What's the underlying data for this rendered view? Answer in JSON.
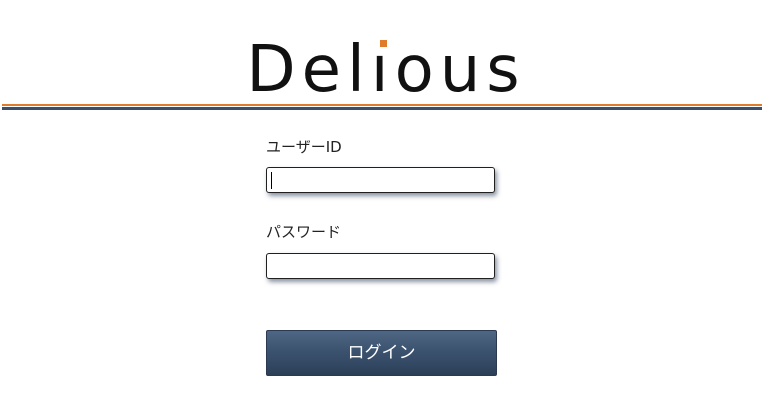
{
  "brand": {
    "logo_prefix": "Del",
    "logo_i": "ı",
    "logo_suffix": "ous",
    "logo_full": "Delious",
    "accent_color": "#e07b2c",
    "navy_color": "#3b4f6b"
  },
  "login_form": {
    "user_id_label": "ユーザーID",
    "user_id_value": "",
    "password_label": "パスワード",
    "password_value": "",
    "submit_label": "ログイン"
  }
}
